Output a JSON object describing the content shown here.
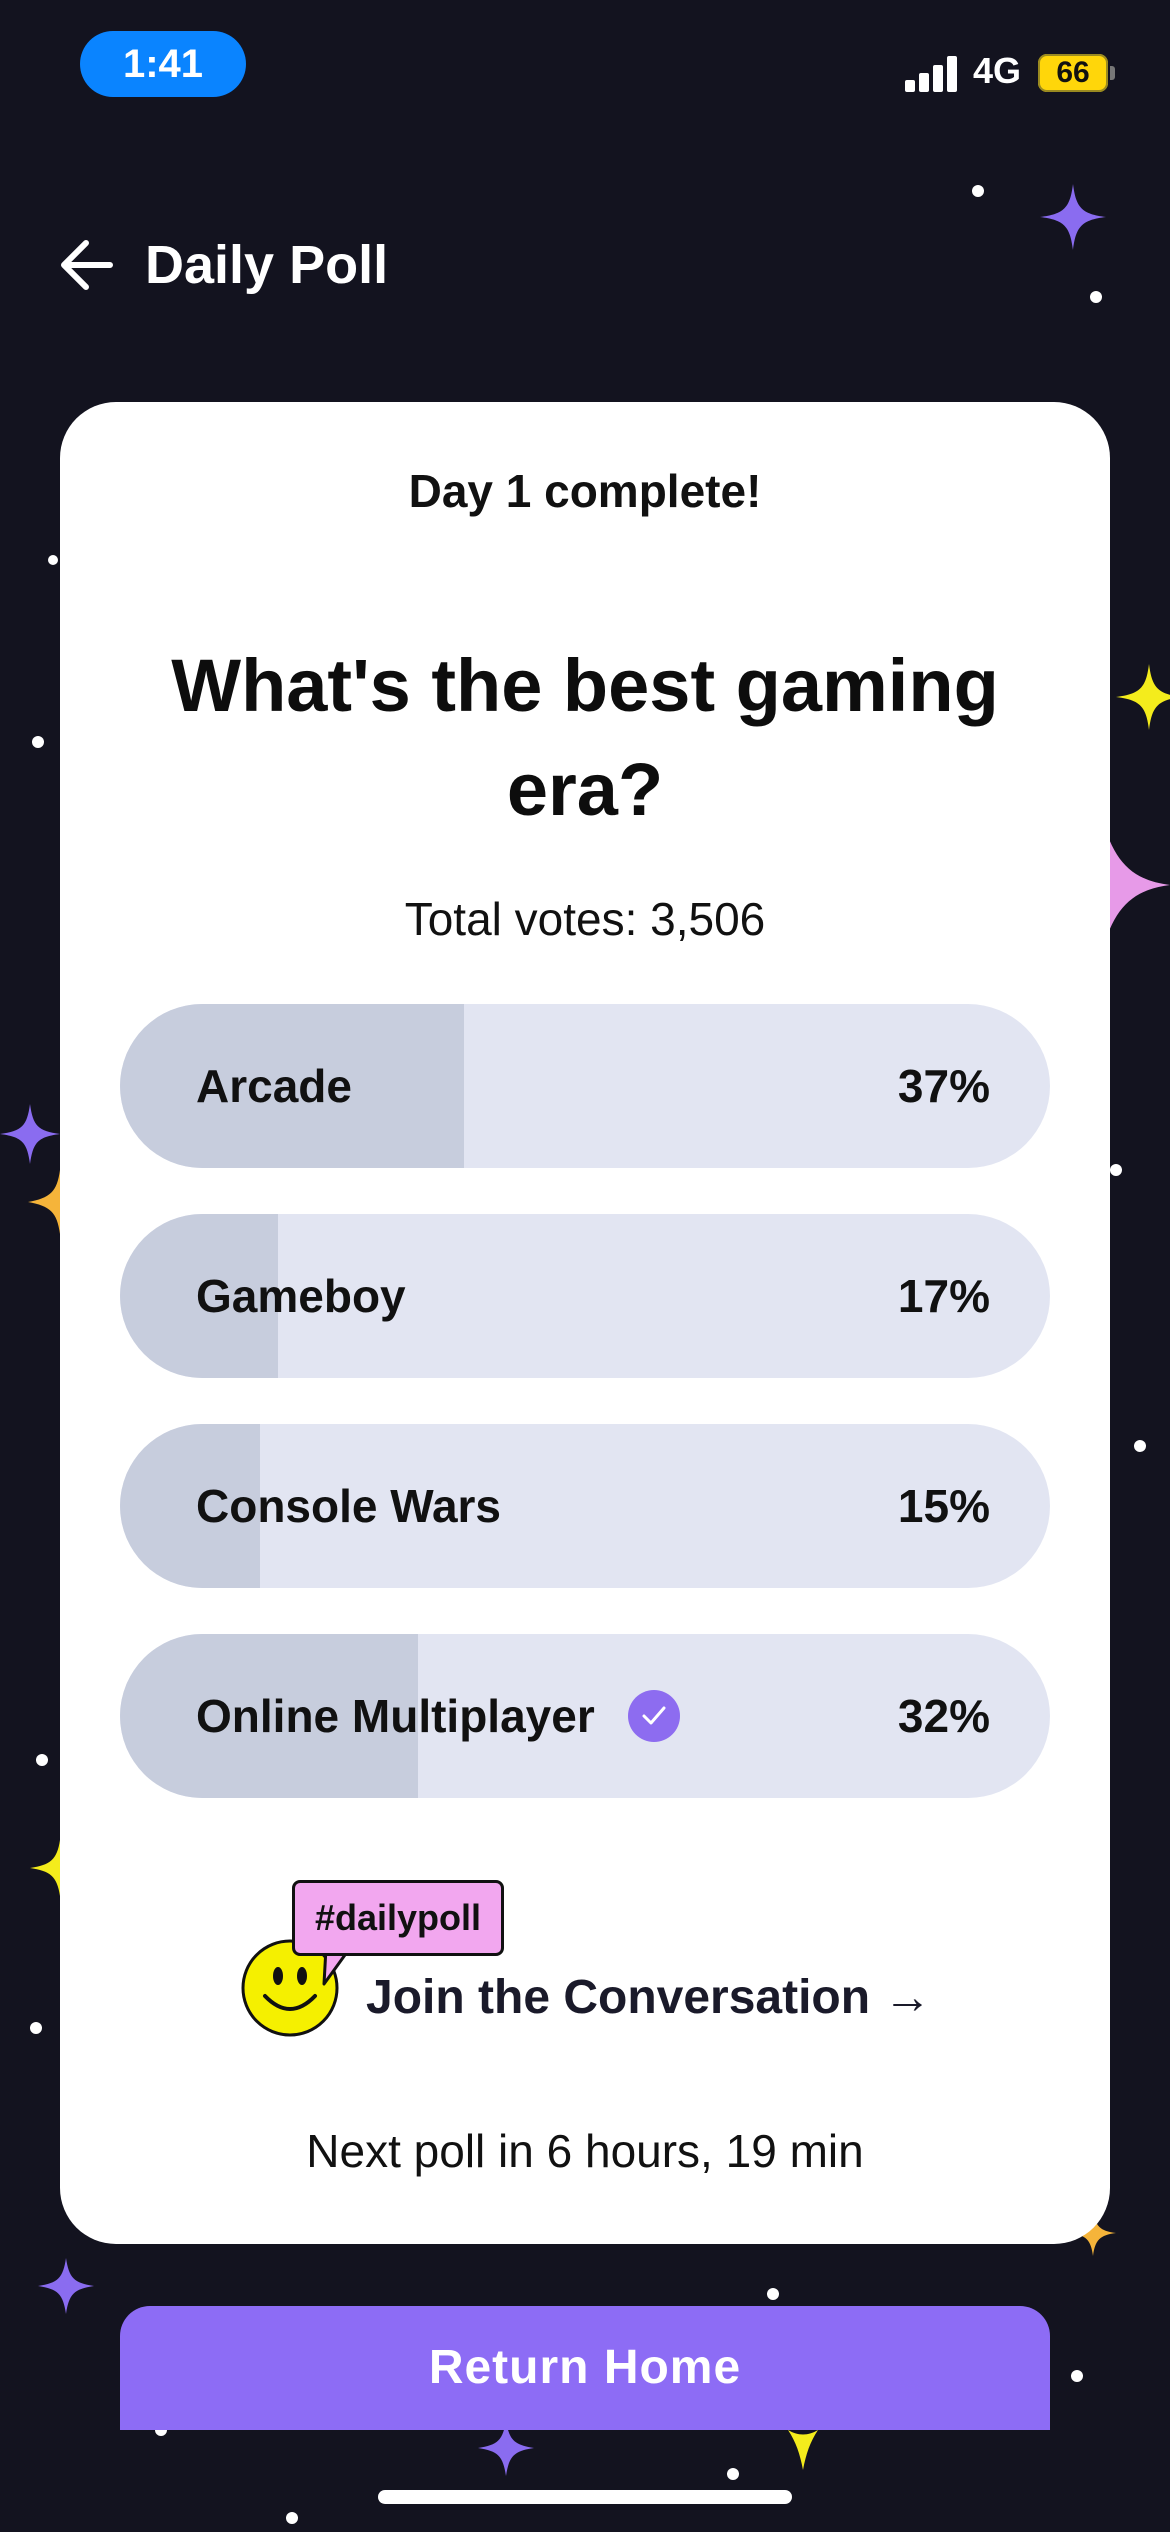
{
  "status_bar": {
    "time": "1:41",
    "network": "4G",
    "battery": "66"
  },
  "header": {
    "title": "Daily Poll"
  },
  "card": {
    "day_complete": "Day 1 complete!",
    "question": "What's the best gaming era?",
    "total_votes": "Total votes: 3,506",
    "options": [
      {
        "label": "Arcade",
        "percent_text": "37%",
        "percent": 37,
        "selected": false
      },
      {
        "label": "Gameboy",
        "percent_text": "17%",
        "percent": 17,
        "selected": false
      },
      {
        "label": "Console Wars",
        "percent_text": "15%",
        "percent": 15,
        "selected": false
      },
      {
        "label": "Online Multiplayer",
        "percent_text": "32%",
        "percent": 32,
        "selected": true
      }
    ],
    "hashtag": "#dailypoll",
    "join_text": "Join the Conversation →",
    "next_poll": "Next poll in 6 hours, 19 min"
  },
  "return_button": "Return Home",
  "colors": {
    "background": "#13131f",
    "accent": "#8d6cf5",
    "option_bg": "#e2e5f2",
    "option_fill": "#c7cddd",
    "tag": "#f2a7ef",
    "smiley": "#f5f000"
  }
}
